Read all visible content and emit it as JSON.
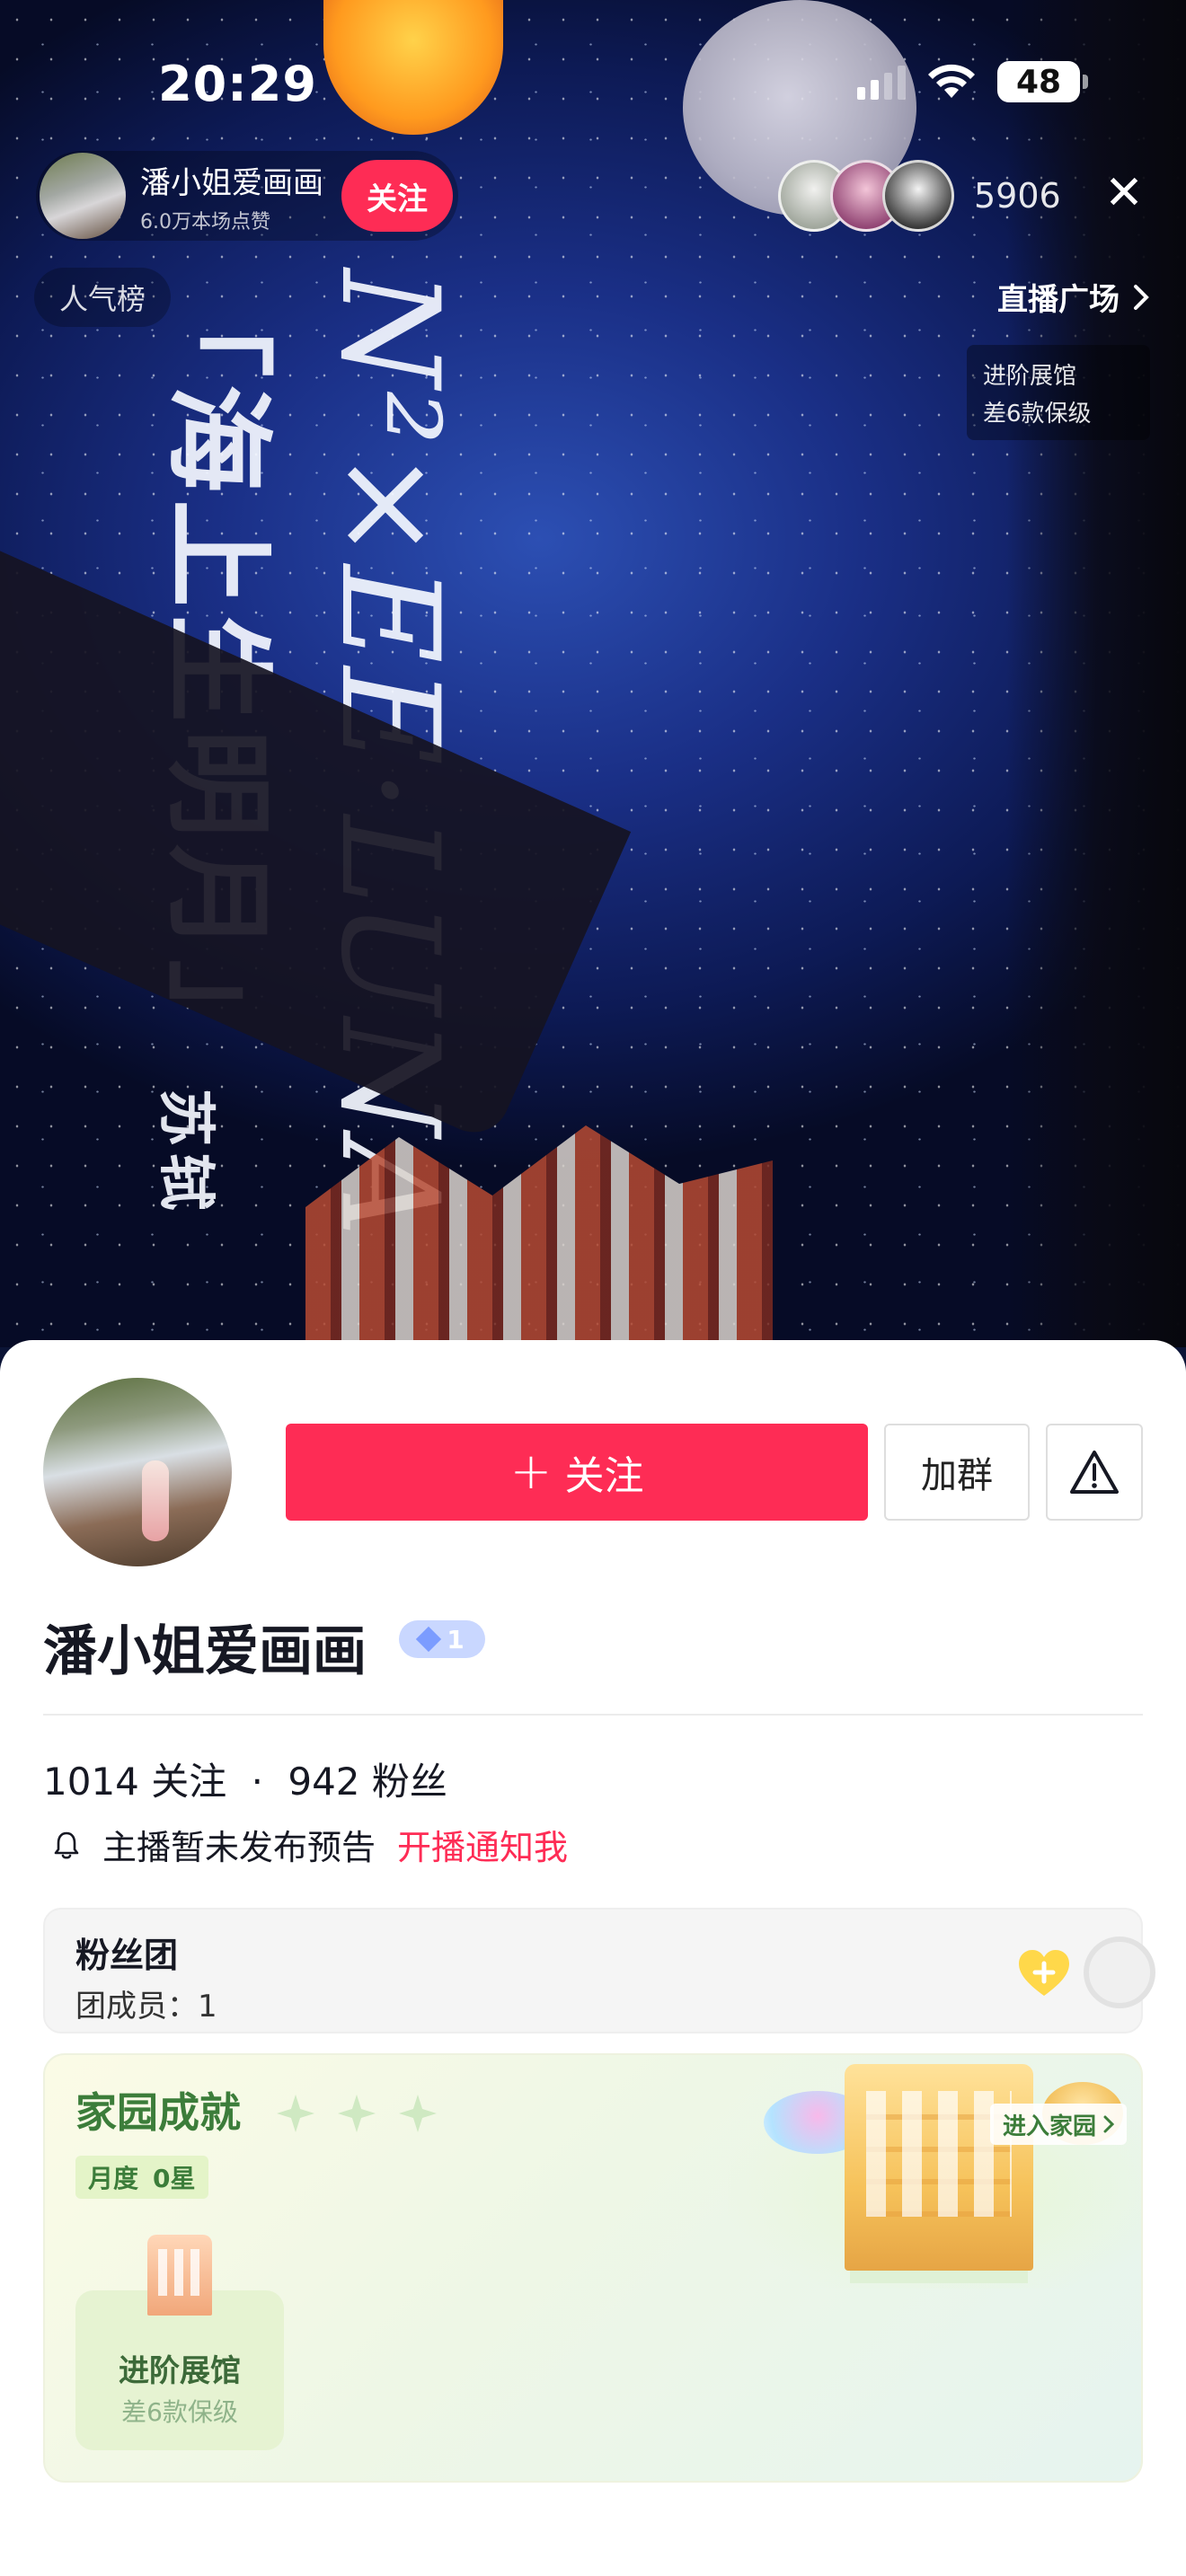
{
  "status_bar": {
    "time": "20:29",
    "battery": "48"
  },
  "room": {
    "anchor_name": "潘小姐爱画画",
    "anchor_likes": "6.0万本场点赞",
    "follow_label": "关注",
    "viewer_count": "5906",
    "rank_label": "人气榜",
    "plaza_label": "直播广场",
    "hall_card": {
      "line1": "进阶展馆",
      "line2": "差6款保级"
    }
  },
  "video": {
    "title_latin": "N²×EE·LUNA",
    "title_cn": "「海上生明月」",
    "title_tag": "苏轼"
  },
  "profile": {
    "follow_button": "关注",
    "join_group_button": "加群",
    "name": "潘小姐爱画画",
    "level": "1",
    "following_count": "1014",
    "following_label": "关注",
    "fans_count": "942",
    "fans_label": "粉丝",
    "separator": "·",
    "notice_text": "主播暂未发布预告",
    "notice_link": "开播通知我"
  },
  "fan_club": {
    "title": "粉丝团",
    "members": "团成员：1"
  },
  "home": {
    "title": "家园成就",
    "month_label": "月度",
    "month_value": "0星",
    "enter_label": "进入家园",
    "hall_title": "进阶展馆",
    "hall_sub": "差6款保级"
  },
  "colors": {
    "accent": "#fe2c55",
    "home_green": "#3c7d3a"
  }
}
